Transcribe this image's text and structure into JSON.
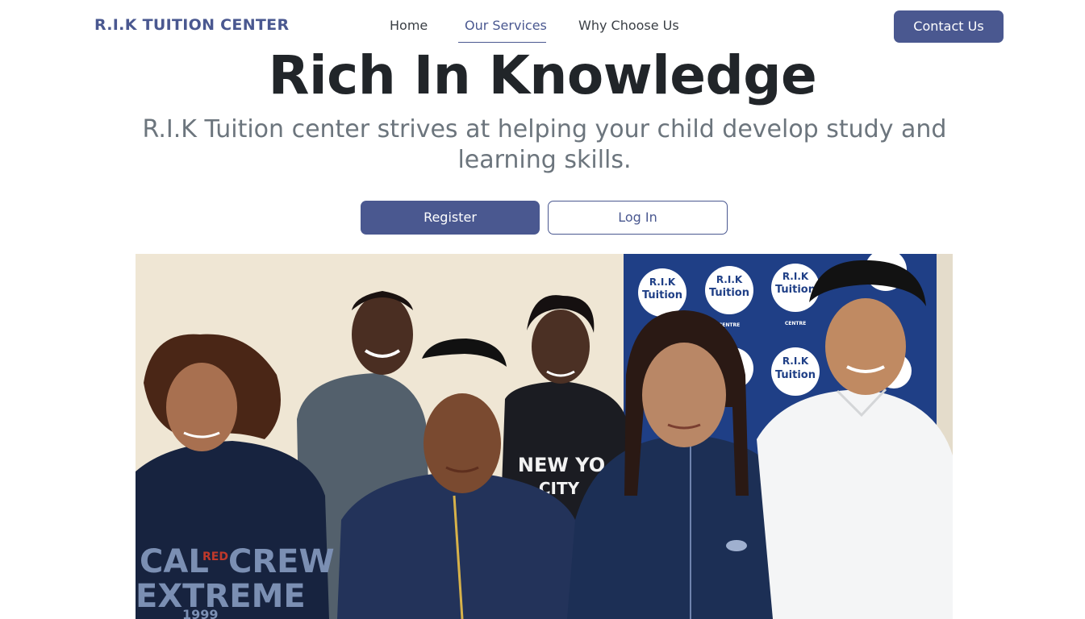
{
  "nav": {
    "brand": "R.I.K TUITION CENTER",
    "links": [
      {
        "label": "Home",
        "active": false
      },
      {
        "label": "Our Services",
        "active": true
      },
      {
        "label": "Why Choose Us",
        "active": false
      }
    ],
    "contact_label": "Contact Us"
  },
  "hero": {
    "title": "Rich In Knowledge",
    "subtitle": "R.I.K Tuition center strives at helping your child develop study and learning skills.",
    "register_label": "Register",
    "login_label": "Log In"
  },
  "photo": {
    "banner_logo_line1": "R.I.K",
    "banner_logo_line2": "Tuition",
    "banner_logo_line3": "CENTRE",
    "shirt_text_1_line1": "CAL",
    "shirt_text_1_red": "RED",
    "shirt_text_1_line1b": "CREW",
    "shirt_text_1_line2": "EXTREME",
    "shirt_text_1_line3": "1999",
    "shirt_text_2_line1": "NEW YO",
    "shirt_text_2_line2": "CITY"
  },
  "colors": {
    "accent": "#4a5890",
    "title": "#212529",
    "subtitle": "#6c757d",
    "nav_text": "#3a3f45"
  }
}
